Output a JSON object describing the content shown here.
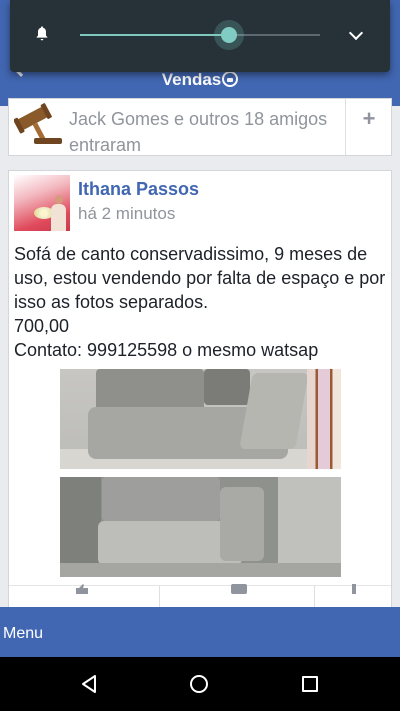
{
  "volume": {
    "level": 0.62,
    "accent": "#80cbc4",
    "icons": [
      "bell-icon",
      "chevron-down-icon"
    ]
  },
  "header": {
    "title": "Vendas",
    "title_icon": "lock-icon",
    "back_icon": "back-arrow-icon"
  },
  "join_card": {
    "text": "Jack Gomes e outros 18 amigos entraram",
    "icon": "gavel-icon",
    "action_label": "+"
  },
  "post": {
    "author": "Ithana Passos",
    "time": "há 2 minutos",
    "text": "Sofá de canto conservadissimo, 9 meses de uso, estou vendendo por falta de espaço e por isso as fotos separados.\n700,00\nContato: 999125598 o mesmo watsap",
    "photos": [
      "photo-1",
      "photo-2"
    ]
  },
  "footer": {
    "menu_label": "Menu"
  },
  "android_nav": {
    "icons": [
      "nav-back-icon",
      "nav-home-icon",
      "nav-recent-icon"
    ]
  },
  "colors": {
    "brand": "#4267b2",
    "overlay": "#263238",
    "link": "#4267b2",
    "muted": "#90949c"
  }
}
